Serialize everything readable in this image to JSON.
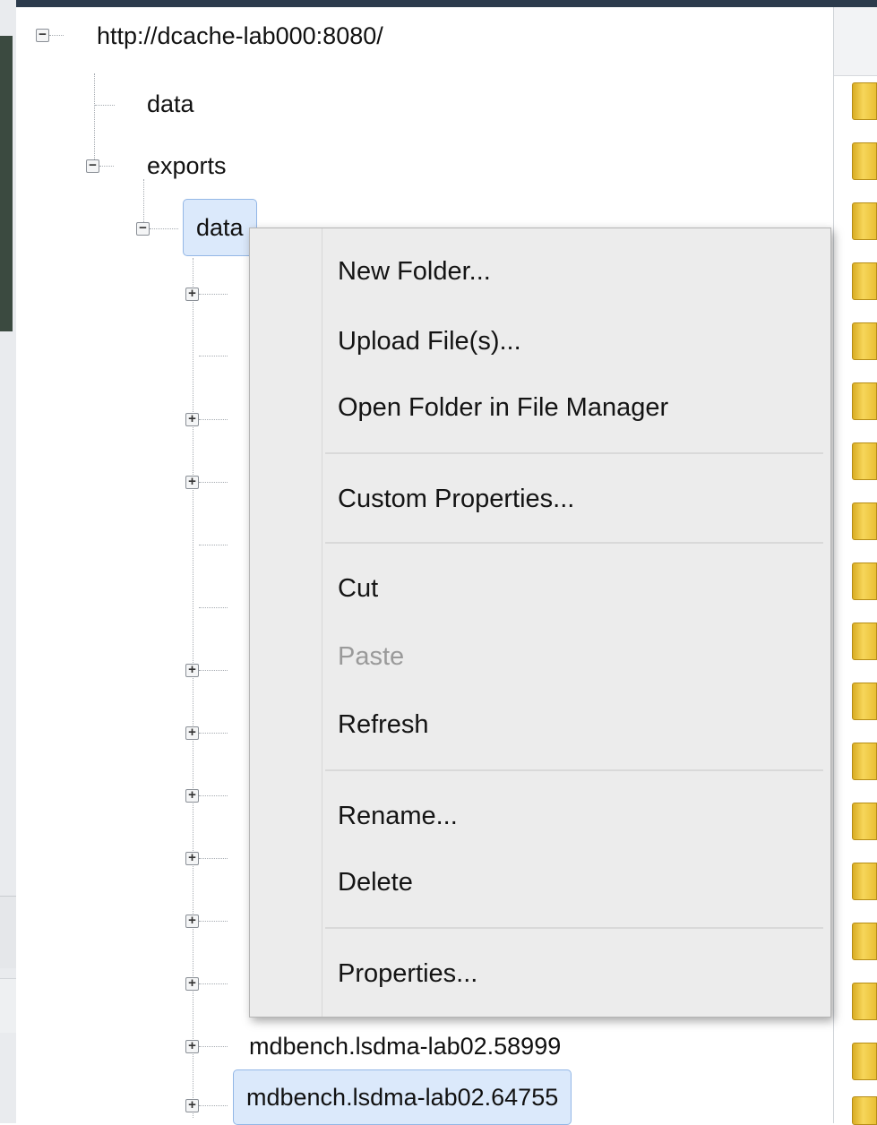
{
  "tree": {
    "root": "http://dcache-lab000:8080/",
    "items": [
      {
        "label": "data"
      },
      {
        "label": "exports"
      },
      {
        "label": "data"
      }
    ],
    "bottom_items": [
      {
        "label": "mdbench.lsdma-lab02.58999"
      },
      {
        "label": "mdbench.lsdma-lab02.64755"
      }
    ]
  },
  "context_menu": {
    "items": [
      {
        "label": "New Folder..."
      },
      {
        "label": "Upload File(s)..."
      },
      {
        "label": "Open Folder in File Manager"
      },
      {
        "label": "Custom Properties..."
      },
      {
        "label": "Cut"
      },
      {
        "label": "Paste",
        "disabled": true
      },
      {
        "label": "Refresh"
      },
      {
        "label": "Rename..."
      },
      {
        "label": "Delete"
      },
      {
        "label": "Properties..."
      }
    ]
  },
  "colors": {
    "selection_fill": "#dbe9fb",
    "selection_border": "#93b7e6",
    "menu_bg": "#ececec",
    "folder_yellow": "#f7d65a"
  }
}
